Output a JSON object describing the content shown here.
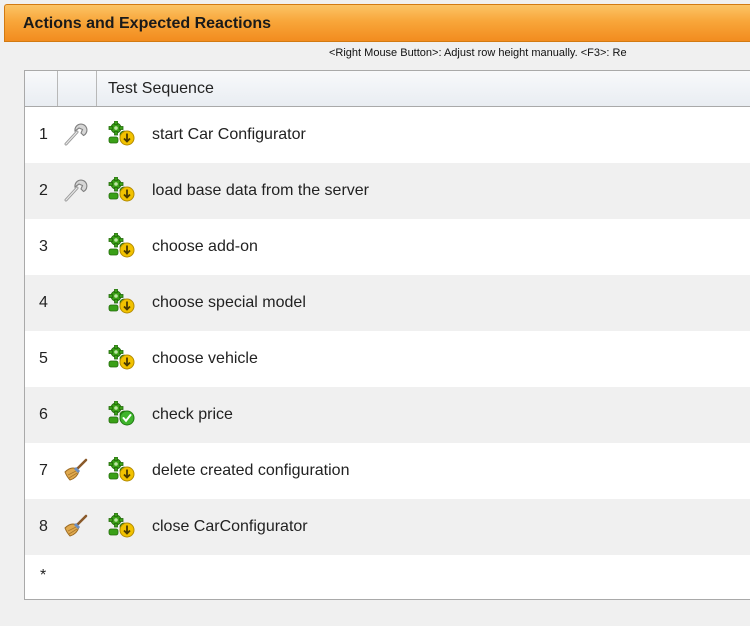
{
  "panel": {
    "title": "Actions and Expected Reactions",
    "hint": "<Right Mouse Button>: Adjust row height manually. <F3>: Re"
  },
  "table": {
    "columns": [
      "",
      "",
      "Test Sequence"
    ],
    "rows": [
      {
        "num": "1",
        "tool_icon": "wrench-icon",
        "action_icon": "gear-add-icon",
        "label": "start Car Configurator"
      },
      {
        "num": "2",
        "tool_icon": "wrench-icon",
        "action_icon": "gear-add-icon",
        "label": "load base data from the server"
      },
      {
        "num": "3",
        "tool_icon": "",
        "action_icon": "gear-add-icon",
        "label": "choose add-on"
      },
      {
        "num": "4",
        "tool_icon": "",
        "action_icon": "gear-add-icon",
        "label": "choose special model"
      },
      {
        "num": "5",
        "tool_icon": "",
        "action_icon": "gear-add-icon",
        "label": "choose vehicle"
      },
      {
        "num": "6",
        "tool_icon": "",
        "action_icon": "gear-check-icon",
        "label": "check price"
      },
      {
        "num": "7",
        "tool_icon": "broom-icon",
        "action_icon": "gear-add-icon",
        "label": "delete created configuration"
      },
      {
        "num": "8",
        "tool_icon": "broom-icon",
        "action_icon": "gear-add-icon",
        "label": "close CarConfigurator"
      }
    ],
    "new_row_marker": "*"
  },
  "colors": {
    "header_orange": "#f8a63a",
    "gear_green": "#3aa017",
    "badge_yellow": "#f2c200",
    "badge_check_green": "#3fb52c"
  }
}
